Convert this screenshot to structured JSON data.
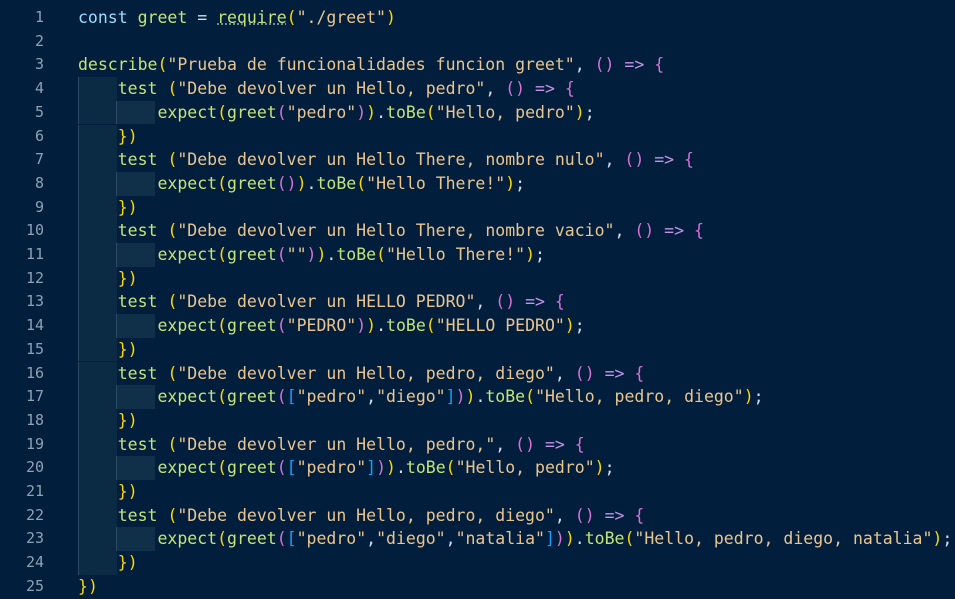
{
  "editor": {
    "lines": [
      {
        "n": "1",
        "text": "const greet = require(\"./greet\")"
      },
      {
        "n": "2",
        "text": ""
      },
      {
        "n": "3",
        "text": "describe(\"Prueba de funcionalidades funcion greet\", () => {"
      },
      {
        "n": "4",
        "text": "    test (\"Debe devolver un Hello, pedro\", () => {"
      },
      {
        "n": "5",
        "text": "        expect(greet(\"pedro\")).toBe(\"Hello, pedro\");"
      },
      {
        "n": "6",
        "text": "    })"
      },
      {
        "n": "7",
        "text": "    test (\"Debe devolver un Hello There, nombre nulo\", () => {"
      },
      {
        "n": "8",
        "text": "        expect(greet()).toBe(\"Hello There!\");"
      },
      {
        "n": "9",
        "text": "    })"
      },
      {
        "n": "10",
        "text": "    test (\"Debe devolver un Hello There, nombre vacio\", () => {"
      },
      {
        "n": "11",
        "text": "        expect(greet(\"\")).toBe(\"Hello There!\");"
      },
      {
        "n": "12",
        "text": "    })"
      },
      {
        "n": "13",
        "text": "    test (\"Debe devolver un HELLO PEDRO\", () => {"
      },
      {
        "n": "14",
        "text": "        expect(greet(\"PEDRO\")).toBe(\"HELLO PEDRO\");"
      },
      {
        "n": "15",
        "text": "    })"
      },
      {
        "n": "16",
        "text": "    test (\"Debe devolver un Hello, pedro, diego\", () => {"
      },
      {
        "n": "17",
        "text": "        expect(greet([\"pedro\",\"diego\"])).toBe(\"Hello, pedro, diego\");"
      },
      {
        "n": "18",
        "text": "    })"
      },
      {
        "n": "19",
        "text": "    test (\"Debe devolver un Hello, pedro,\", () => {"
      },
      {
        "n": "20",
        "text": "        expect(greet([\"pedro\"])).toBe(\"Hello, pedro\");"
      },
      {
        "n": "21",
        "text": "    })"
      },
      {
        "n": "22",
        "text": "    test (\"Debe devolver un Hello, pedro, diego\", () => {"
      },
      {
        "n": "23",
        "text": "        expect(greet([\"pedro\",\"diego\",\"natalia\"])).toBe(\"Hello, pedro, diego, natalia\");"
      },
      {
        "n": "24",
        "text": "    })"
      },
      {
        "n": "25",
        "text": "})"
      }
    ]
  },
  "colors": {
    "background": "#011f3d",
    "keyword": "#9cdcfe",
    "function": "#c5e478",
    "string": "#ecc48d",
    "bracket_level1": "#ffd700",
    "bracket_level2": "#da70d6",
    "bracket_level3": "#179fff",
    "line_number": "#8fa1b3"
  }
}
